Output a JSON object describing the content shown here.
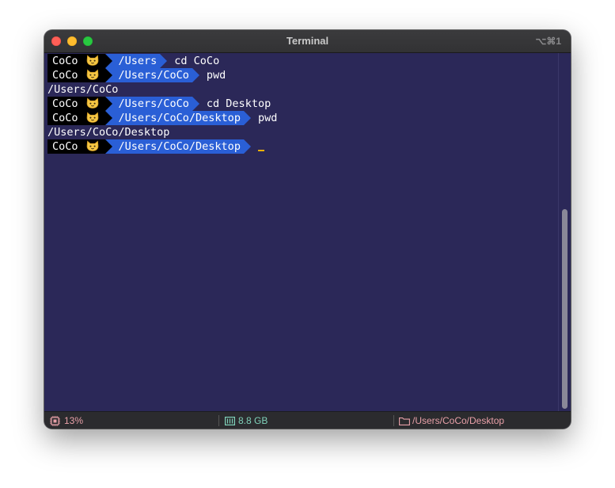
{
  "window": {
    "title": "Terminal",
    "shortcut": "⌥⌘1"
  },
  "terminal": {
    "lines": [
      {
        "type": "prompt",
        "user": "CoCo",
        "path": "/Users",
        "command": "cd CoCo"
      },
      {
        "type": "prompt",
        "user": "CoCo",
        "path": "/Users/CoCo",
        "command": "pwd"
      },
      {
        "type": "output",
        "text": "/Users/CoCo"
      },
      {
        "type": "prompt",
        "user": "CoCo",
        "path": "/Users/CoCo",
        "command": "cd Desktop"
      },
      {
        "type": "prompt",
        "user": "CoCo",
        "path": "/Users/CoCo/Desktop",
        "command": "pwd"
      },
      {
        "type": "output",
        "text": "/Users/CoCo/Desktop"
      },
      {
        "type": "prompt",
        "user": "CoCo",
        "path": "/Users/CoCo/Desktop",
        "command": ""
      }
    ],
    "prompt_user_icon": "cat-face-icon",
    "colors": {
      "background": "#2b2858",
      "user_segment": "#000000",
      "path_segment": "#2a5fd6",
      "cursor": "#f0b000"
    }
  },
  "statusbar": {
    "cpu": {
      "icon": "cpu-icon",
      "value": "13%",
      "color": "#e8a0a8"
    },
    "memory": {
      "icon": "memory-icon",
      "value": "8.8 GB",
      "color": "#7fd1b9"
    },
    "directory": {
      "icon": "folder-icon",
      "value": "/Users/CoCo/Desktop",
      "color": "#e8a0a8"
    }
  }
}
